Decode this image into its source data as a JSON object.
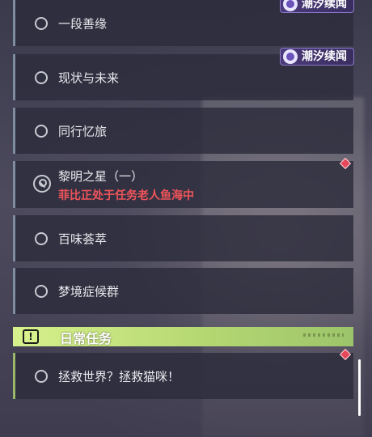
{
  "colors": {
    "accent_green": "#c8e87e",
    "quest_red": "#f0545a",
    "badge_purple": "#4a3a7a",
    "notify_red": "#e5485a"
  },
  "badges": {
    "badge1": "潮汐续闻",
    "badge2": "潮汐续闻"
  },
  "quests": [
    {
      "title": "一段善缘"
    },
    {
      "title": "现状与未来"
    },
    {
      "title": "同行忆旅"
    },
    {
      "title": "黎明之星（一）",
      "subtitle": "菲比正处于任务老人鱼海中"
    },
    {
      "title": "百味荟萃"
    },
    {
      "title": "梦境症候群"
    }
  ],
  "daily_section": {
    "title": "日常任务",
    "icon": "alert-icon",
    "quests": [
      {
        "title": "拯救世界？拯救猫咪！"
      }
    ]
  }
}
